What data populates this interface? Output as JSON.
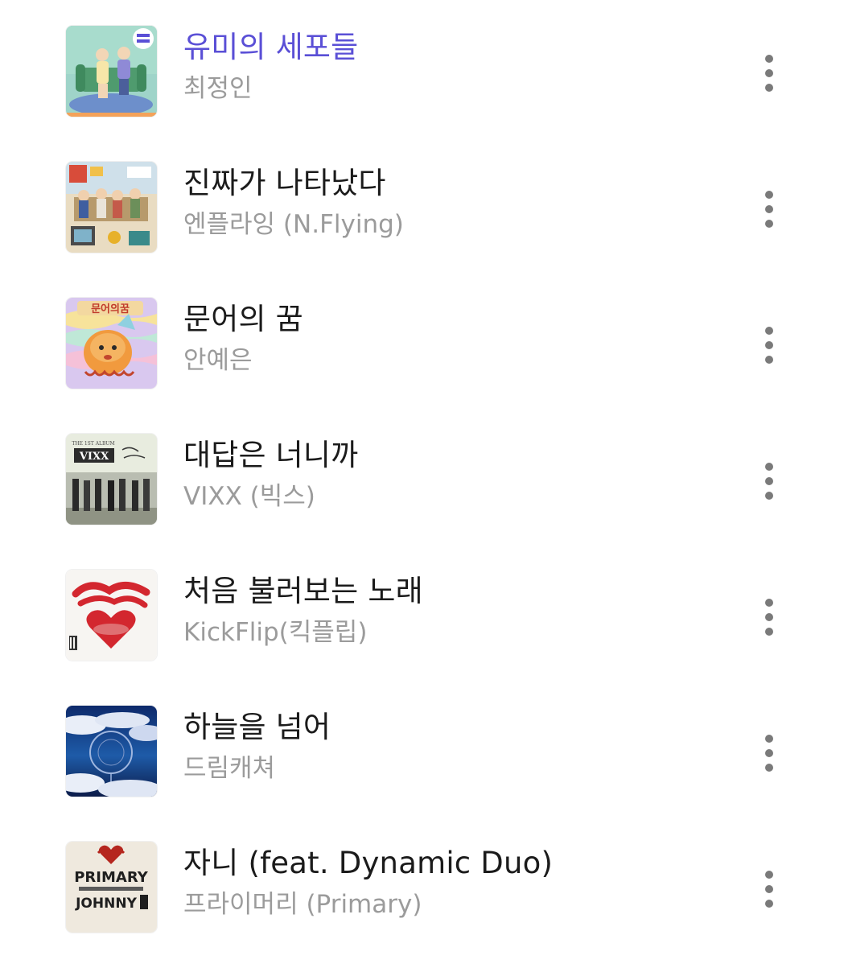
{
  "tracks": [
    {
      "title": "유미의 세포들",
      "artist": "최정인",
      "playing": true,
      "cover": "yumi-cells-cover"
    },
    {
      "title": "진짜가 나타났다",
      "artist": "엔플라잉 (N.Flying)",
      "playing": false,
      "cover": "nflying-cover"
    },
    {
      "title": "문어의 꿈",
      "artist": "안예은",
      "playing": false,
      "cover": "octopus-dream-cover"
    },
    {
      "title": "대답은 너니까",
      "artist": "VIXX (빅스)",
      "playing": false,
      "cover": "vixx-cover"
    },
    {
      "title": "처음 불러보는 노래",
      "artist": "KickFlip(킥플립)",
      "playing": false,
      "cover": "kickflip-cover"
    },
    {
      "title": "하늘을 넘어",
      "artist": "드림캐쳐",
      "playing": false,
      "cover": "dreamcatcher-cover"
    },
    {
      "title": "자니 (feat. Dynamic Duo)",
      "artist": "프라이머리 (Primary)",
      "playing": false,
      "cover": "primary-johnny-cover"
    }
  ],
  "covers": {
    "vixx_brand": "VIXX",
    "vixx_album": "THE 1ST ALBUM",
    "primary_line1": "PRIMARY",
    "primary_line2": "JOHNNY",
    "octopus_text": "문어의꿈"
  },
  "more_icon": "more-vertical-icon",
  "colors": {
    "playing_title": "#5a4fd6",
    "title": "#1b1b1b",
    "artist": "#9b9b9b",
    "more_dots": "#7a7a7a"
  }
}
